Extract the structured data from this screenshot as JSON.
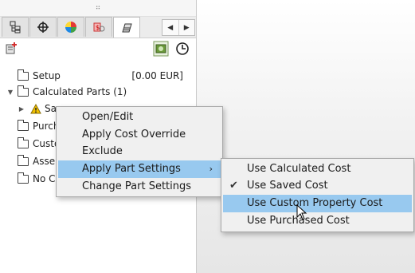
{
  "panel": {
    "grip_label": "⠶",
    "tabs": [
      {
        "icon": "featuremanager-tree-icon"
      },
      {
        "icon": "dimxpert-crosshair-icon"
      },
      {
        "icon": "display-manager-pie-icon"
      },
      {
        "icon": "costing-icon"
      },
      {
        "icon": "appearance-icon"
      }
    ],
    "scroll_left": "◀",
    "scroll_right": "▶"
  },
  "tree": {
    "items": [
      {
        "label": "Setup",
        "value": "[0.00 EUR]"
      },
      {
        "label": "Calculated Parts (1)"
      },
      {
        "label": "Sa"
      },
      {
        "label": "Purch"
      },
      {
        "label": "Custo"
      },
      {
        "label": "Asser"
      },
      {
        "label": "No Co"
      }
    ]
  },
  "context_menu": {
    "items": [
      {
        "label": "Open/Edit"
      },
      {
        "label": "Apply Cost Override"
      },
      {
        "label": "Exclude"
      },
      {
        "label": "Apply Part Settings",
        "submenu_arrow": "›"
      },
      {
        "label": "Change Part Settings"
      }
    ]
  },
  "submenu": {
    "items": [
      {
        "label": "Use Calculated Cost"
      },
      {
        "label": "Use Saved Cost",
        "check": "✔"
      },
      {
        "label": "Use Custom Property Cost"
      },
      {
        "label": "Use Purchased Cost"
      }
    ]
  },
  "colors": {
    "menu_highlight": "#98c9ef",
    "warning": "#f2c200"
  }
}
